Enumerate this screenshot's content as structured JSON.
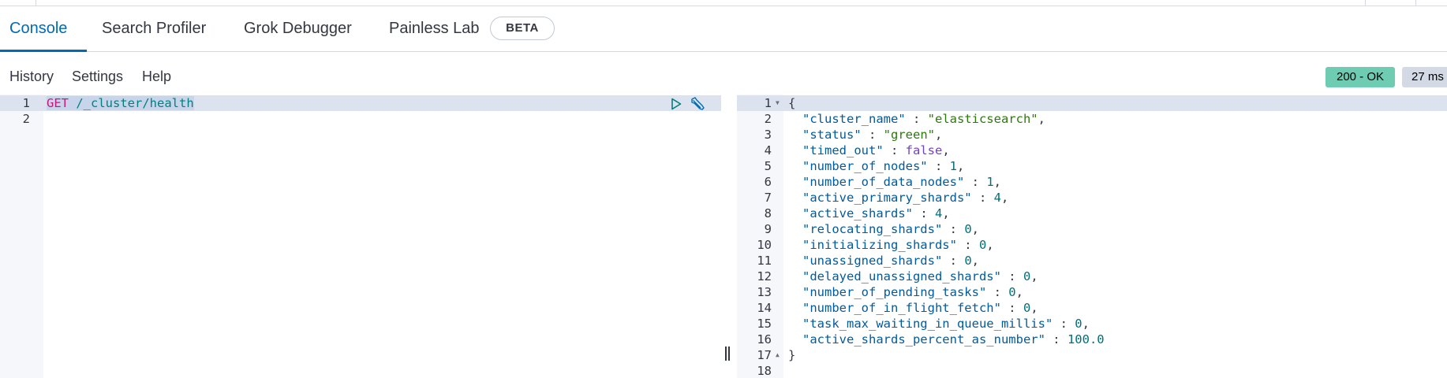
{
  "tabs": [
    {
      "label": "Console"
    },
    {
      "label": "Search Profiler"
    },
    {
      "label": "Grok Debugger"
    },
    {
      "label": "Painless Lab"
    }
  ],
  "beta_badge": "BETA",
  "menu": {
    "history": "History",
    "settings": "Settings",
    "help": "Help"
  },
  "response_status": "200 - OK",
  "response_time": "27 ms",
  "request": {
    "line_numbers": [
      "1",
      "2"
    ],
    "method": "GET",
    "path": "/_cluster/health"
  },
  "response": {
    "line_numbers": [
      "1",
      "2",
      "3",
      "4",
      "5",
      "6",
      "7",
      "8",
      "9",
      "10",
      "11",
      "12",
      "13",
      "14",
      "15",
      "16",
      "17",
      "18"
    ],
    "open_brace": "{",
    "close_brace": "}",
    "fields": [
      {
        "key": "\"cluster_name\"",
        "sep": " : ",
        "value": "\"elasticsearch\"",
        "comma": ",",
        "type": "s"
      },
      {
        "key": "\"status\"",
        "sep": " : ",
        "value": "\"green\"",
        "comma": ",",
        "type": "s"
      },
      {
        "key": "\"timed_out\"",
        "sep": " : ",
        "value": "false",
        "comma": ",",
        "type": "b"
      },
      {
        "key": "\"number_of_nodes\"",
        "sep": " : ",
        "value": "1",
        "comma": ",",
        "type": "n"
      },
      {
        "key": "\"number_of_data_nodes\"",
        "sep": " : ",
        "value": "1",
        "comma": ",",
        "type": "n"
      },
      {
        "key": "\"active_primary_shards\"",
        "sep": " : ",
        "value": "4",
        "comma": ",",
        "type": "n"
      },
      {
        "key": "\"active_shards\"",
        "sep": " : ",
        "value": "4",
        "comma": ",",
        "type": "n"
      },
      {
        "key": "\"relocating_shards\"",
        "sep": " : ",
        "value": "0",
        "comma": ",",
        "type": "n"
      },
      {
        "key": "\"initializing_shards\"",
        "sep": " : ",
        "value": "0",
        "comma": ",",
        "type": "n"
      },
      {
        "key": "\"unassigned_shards\"",
        "sep": " : ",
        "value": "0",
        "comma": ",",
        "type": "n"
      },
      {
        "key": "\"delayed_unassigned_shards\"",
        "sep": " : ",
        "value": "0",
        "comma": ",",
        "type": "n"
      },
      {
        "key": "\"number_of_pending_tasks\"",
        "sep": " : ",
        "value": "0",
        "comma": ",",
        "type": "n"
      },
      {
        "key": "\"number_of_in_flight_fetch\"",
        "sep": " : ",
        "value": "0",
        "comma": ",",
        "type": "n"
      },
      {
        "key": "\"task_max_waiting_in_queue_millis\"",
        "sep": " : ",
        "value": "0",
        "comma": ",",
        "type": "n"
      },
      {
        "key": "\"active_shards_percent_as_number\"",
        "sep": " : ",
        "value": "100.0",
        "comma": "",
        "type": "n"
      }
    ]
  },
  "icons": {
    "run": "play-icon",
    "settings": "wrench-icon",
    "resize": "resize-handle"
  },
  "colors": {
    "accent": "#006bb4",
    "status_ok": "#6dccb1",
    "time_badge": "#d3dae6"
  }
}
